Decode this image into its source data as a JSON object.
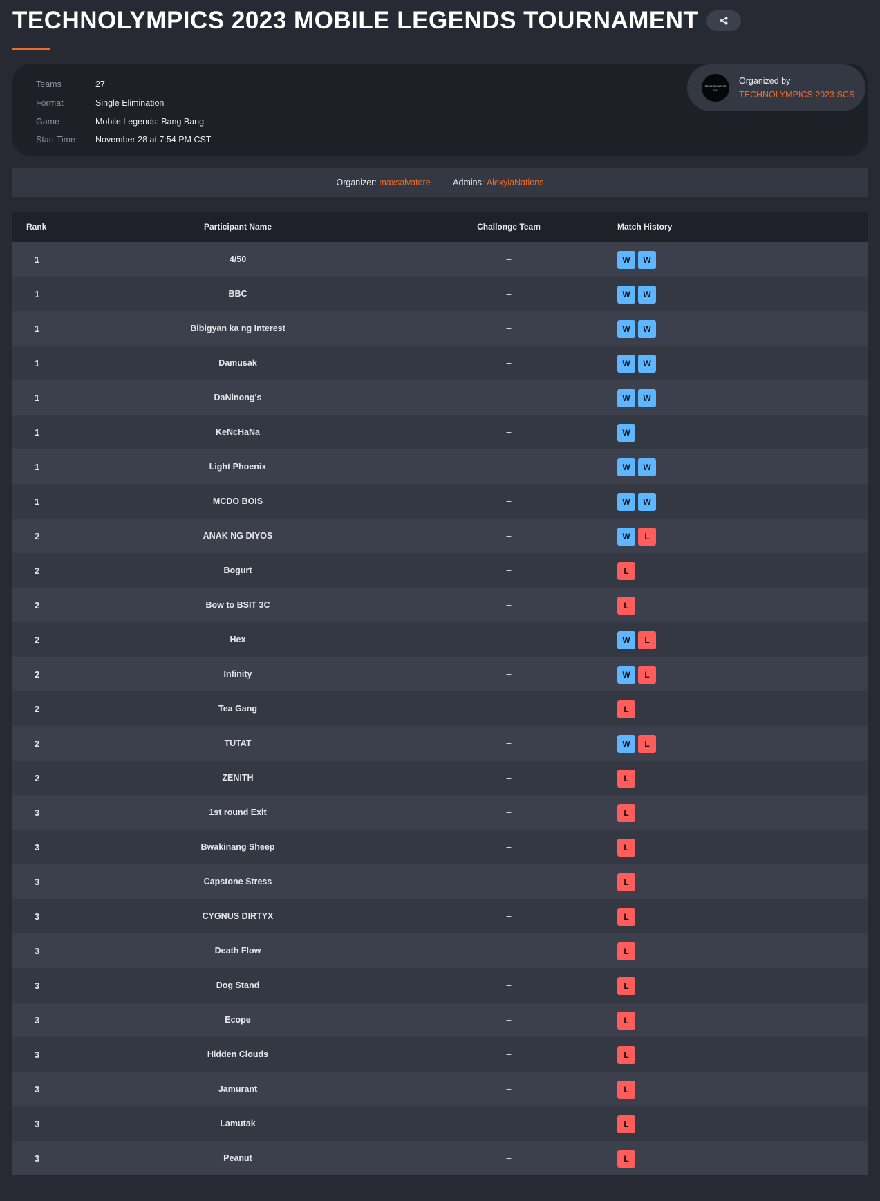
{
  "header": {
    "title": "TECHNOLYMPICS 2023 MOBILE LEGENDS TOURNAMENT"
  },
  "info": {
    "rows": [
      {
        "label": "Teams",
        "value": "27"
      },
      {
        "label": "Format",
        "value": "Single Elimination"
      },
      {
        "label": "Game",
        "value": "Mobile Legends: Bang Bang"
      },
      {
        "label": "Start Time",
        "value": "November 28 at 7:54 PM CST"
      }
    ],
    "organized_by_label": "Organized by",
    "organizer_name": "TECHNOLYMPICS 2023 SCS",
    "logo_text_top": "TECHNOLYMPICS",
    "logo_text_bottom": "2023"
  },
  "staff": {
    "organizer_label": "Organizer:",
    "organizer": "maxsalvatore",
    "separator": "—",
    "admins_label": "Admins:",
    "admins": "AlexyiaNations"
  },
  "table": {
    "headers": [
      "Rank",
      "Participant Name",
      "Challonge Team",
      "Match History"
    ],
    "rows": [
      {
        "rank": "1",
        "name": "4/50",
        "team": "–",
        "history": [
          "W",
          "W"
        ]
      },
      {
        "rank": "1",
        "name": "BBC",
        "team": "–",
        "history": [
          "W",
          "W"
        ]
      },
      {
        "rank": "1",
        "name": "Bibigyan ka ng Interest",
        "team": "–",
        "history": [
          "W",
          "W"
        ]
      },
      {
        "rank": "1",
        "name": "Damusak",
        "team": "–",
        "history": [
          "W",
          "W"
        ]
      },
      {
        "rank": "1",
        "name": "DaNinong's",
        "team": "–",
        "history": [
          "W",
          "W"
        ]
      },
      {
        "rank": "1",
        "name": "KeNcHaNa",
        "team": "–",
        "history": [
          "W"
        ]
      },
      {
        "rank": "1",
        "name": "Light Phoenix",
        "team": "–",
        "history": [
          "W",
          "W"
        ]
      },
      {
        "rank": "1",
        "name": "MCDO BOIS",
        "team": "–",
        "history": [
          "W",
          "W"
        ]
      },
      {
        "rank": "2",
        "name": "ANAK NG DIYOS",
        "team": "–",
        "history": [
          "W",
          "L"
        ]
      },
      {
        "rank": "2",
        "name": "Bogurt",
        "team": "–",
        "history": [
          "L"
        ]
      },
      {
        "rank": "2",
        "name": "Bow to BSIT 3C",
        "team": "–",
        "history": [
          "L"
        ]
      },
      {
        "rank": "2",
        "name": "Hex",
        "team": "–",
        "history": [
          "W",
          "L"
        ]
      },
      {
        "rank": "2",
        "name": "Infinity",
        "team": "–",
        "history": [
          "W",
          "L"
        ]
      },
      {
        "rank": "2",
        "name": "Tea Gang",
        "team": "–",
        "history": [
          "L"
        ]
      },
      {
        "rank": "2",
        "name": "TUTAT",
        "team": "–",
        "history": [
          "W",
          "L"
        ]
      },
      {
        "rank": "2",
        "name": "ZENITH",
        "team": "–",
        "history": [
          "L"
        ]
      },
      {
        "rank": "3",
        "name": "1st round Exit",
        "team": "–",
        "history": [
          "L"
        ]
      },
      {
        "rank": "3",
        "name": "Bwakinang Sheep",
        "team": "–",
        "history": [
          "L"
        ]
      },
      {
        "rank": "3",
        "name": "Capstone Stress",
        "team": "–",
        "history": [
          "L"
        ]
      },
      {
        "rank": "3",
        "name": "CYGNUS DIRTYX",
        "team": "–",
        "history": [
          "L"
        ]
      },
      {
        "rank": "3",
        "name": "Death Flow",
        "team": "–",
        "history": [
          "L"
        ]
      },
      {
        "rank": "3",
        "name": "Dog Stand",
        "team": "–",
        "history": [
          "L"
        ]
      },
      {
        "rank": "3",
        "name": "Ecope",
        "team": "–",
        "history": [
          "L"
        ]
      },
      {
        "rank": "3",
        "name": "Hidden Clouds",
        "team": "–",
        "history": [
          "L"
        ]
      },
      {
        "rank": "3",
        "name": "Jamurant",
        "team": "–",
        "history": [
          "L"
        ]
      },
      {
        "rank": "3",
        "name": "Lamutak",
        "team": "–",
        "history": [
          "L"
        ]
      },
      {
        "rank": "3",
        "name": "Peanut",
        "team": "–",
        "history": [
          "L"
        ]
      }
    ]
  },
  "colors": {
    "accent": "#f26b2a",
    "win": "#5db6ff",
    "loss": "#ff5c5c",
    "background": "#272a33"
  },
  "icons": {
    "share": "share-icon"
  }
}
